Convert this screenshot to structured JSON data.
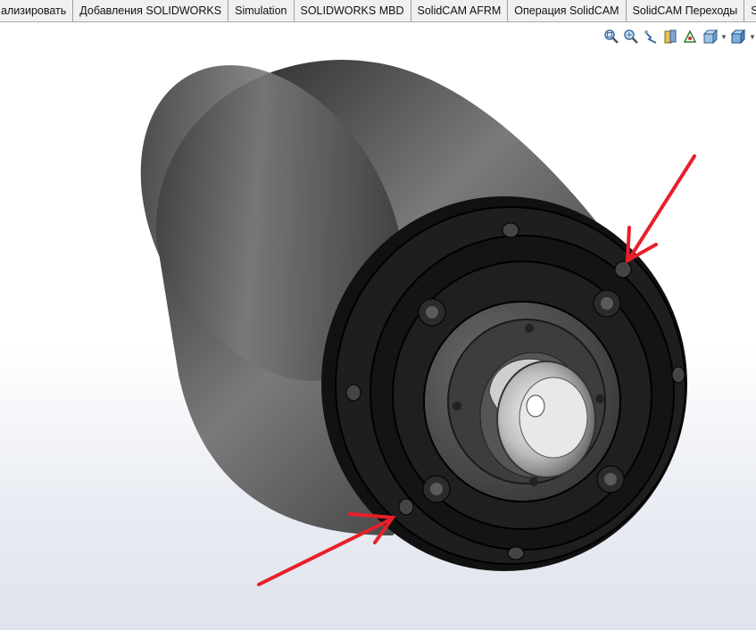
{
  "command_manager": {
    "tabs": [
      "ализировать",
      "Добавления SOLIDWORKS",
      "Simulation",
      "SOLIDWORKS MBD",
      "SolidCAM AFRM",
      "Операция  SolidCAM",
      "SolidCAM Переходы",
      "SolidCAM"
    ]
  },
  "heads_up_toolbar": {
    "icons": [
      "zoom-to-fit-icon",
      "zoom-to-area-icon",
      "previous-view-icon",
      "section-view-icon",
      "view-orientation-icon",
      "display-style-icon",
      "hide-show-items-icon"
    ]
  },
  "colors": {
    "annotation_arrow": "#e8202a",
    "tab_background": "#f0f0f0"
  }
}
